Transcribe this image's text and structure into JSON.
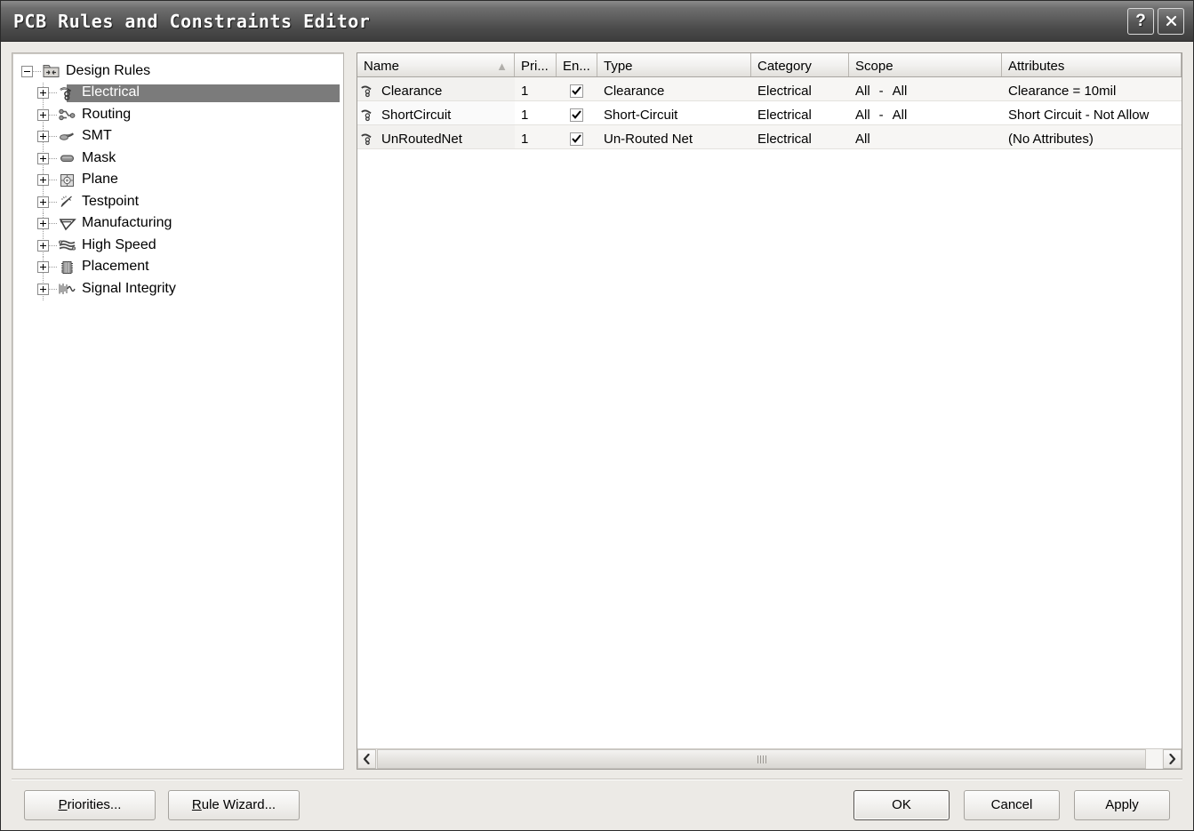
{
  "window": {
    "title": "PCB Rules and Constraints Editor",
    "help_button": "?",
    "close_button": "✕"
  },
  "tree": {
    "root": {
      "label": "Design Rules",
      "icon": "design-rules-folder-icon",
      "expander": "minus"
    },
    "items": [
      {
        "label": "Electrical",
        "icon": "electrical-icon",
        "expander": "plus",
        "selected": true
      },
      {
        "label": "Routing",
        "icon": "routing-icon",
        "expander": "plus",
        "selected": false
      },
      {
        "label": "SMT",
        "icon": "smt-icon",
        "expander": "plus",
        "selected": false
      },
      {
        "label": "Mask",
        "icon": "mask-icon",
        "expander": "plus",
        "selected": false
      },
      {
        "label": "Plane",
        "icon": "plane-icon",
        "expander": "plus",
        "selected": false
      },
      {
        "label": "Testpoint",
        "icon": "testpoint-icon",
        "expander": "plus",
        "selected": false
      },
      {
        "label": "Manufacturing",
        "icon": "manufacturing-icon",
        "expander": "plus",
        "selected": false
      },
      {
        "label": "High Speed",
        "icon": "high-speed-icon",
        "expander": "plus",
        "selected": false
      },
      {
        "label": "Placement",
        "icon": "placement-icon",
        "expander": "plus",
        "selected": false
      },
      {
        "label": "Signal Integrity",
        "icon": "signal-integrity-icon",
        "expander": "plus",
        "selected": false
      }
    ]
  },
  "list": {
    "columns": [
      {
        "key": "name",
        "label": "Name",
        "sort": "ascending",
        "sort_glyph": "▲"
      },
      {
        "key": "priority",
        "label": "Pri...",
        "sort": "none"
      },
      {
        "key": "enabled",
        "label": "En...",
        "sort": "none"
      },
      {
        "key": "type",
        "label": "Type",
        "sort": "none"
      },
      {
        "key": "category",
        "label": "Category",
        "sort": "none"
      },
      {
        "key": "scope",
        "label": "Scope",
        "sort": "none"
      },
      {
        "key": "attributes",
        "label": "Attributes",
        "sort": "none"
      }
    ],
    "rows": [
      {
        "icon": "rule-icon",
        "name": "Clearance",
        "priority": "1",
        "enabled": true,
        "type": "Clearance",
        "category": "Electrical",
        "scope_left": "All",
        "scope_sep": "-",
        "scope_right": "All",
        "attributes": "Clearance = 10mil"
      },
      {
        "icon": "rule-icon",
        "name": "ShortCircuit",
        "priority": "1",
        "enabled": true,
        "type": "Short-Circuit",
        "category": "Electrical",
        "scope_left": "All",
        "scope_sep": "-",
        "scope_right": "All",
        "attributes": "Short Circuit - Not Allow"
      },
      {
        "icon": "rule-icon",
        "name": "UnRoutedNet",
        "priority": "1",
        "enabled": true,
        "type": "Un-Routed Net",
        "category": "Electrical",
        "scope_left": "All",
        "scope_sep": "",
        "scope_right": "",
        "attributes": "(No Attributes)"
      }
    ],
    "scrollbar": {
      "left_arrow": "‹",
      "right_arrow": "›"
    }
  },
  "footer": {
    "priorities_button": "Priorities...",
    "priorities_accel": "P",
    "rule_wizard_button": "Rule Wizard...",
    "rule_wizard_accel": "R",
    "ok_button": "OK",
    "cancel_button": "Cancel",
    "apply_button": "Apply"
  },
  "colors": {
    "title_bar_dark": "#4a4a4a",
    "selection": "#7b7b7b",
    "dialog_face": "#eceae6",
    "panel_white": "#ffffff",
    "border": "#a6a39e"
  }
}
